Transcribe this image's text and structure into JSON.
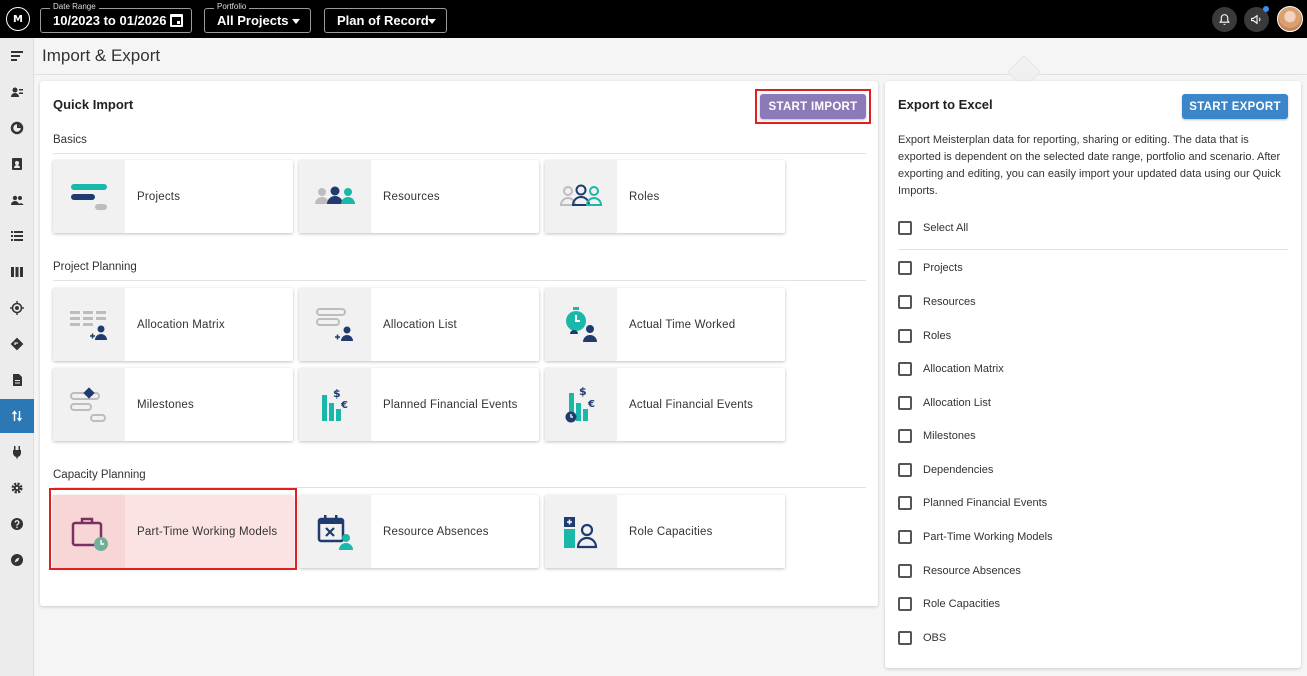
{
  "topbar": {
    "logo_text": "M",
    "date_range": {
      "label": "Date Range",
      "value": "10/2023 to 01/2026"
    },
    "portfolio": {
      "label": "Portfolio",
      "value": "All Projects"
    },
    "scenario": {
      "value": "Plan of Record"
    },
    "icons": [
      "bell-icon",
      "megaphone-icon",
      "user-avatar"
    ]
  },
  "sidebar": {
    "items": [
      "menu-icon",
      "person-list-icon",
      "pie-chart-icon",
      "contact-card-icon",
      "people-icon",
      "list-icon",
      "columns-icon",
      "target-icon",
      "road-sign-icon",
      "document-icon",
      "import-export-icon",
      "plug-icon",
      "gear-icon",
      "help-icon",
      "compass-icon"
    ],
    "active": "import-export-icon"
  },
  "page": {
    "title": "Import & Export"
  },
  "quick_import": {
    "title": "Quick Import",
    "start_button": "START IMPORT",
    "sections": [
      {
        "label": "Basics",
        "cards": [
          "Projects",
          "Resources",
          "Roles"
        ]
      },
      {
        "label": "Project Planning",
        "cards": [
          "Allocation Matrix",
          "Allocation List",
          "Actual Time Worked",
          "Milestones",
          "Planned Financial Events",
          "Actual Financial Events"
        ]
      },
      {
        "label": "Capacity Planning",
        "cards": [
          "Part-Time Working Models",
          "Resource Absences",
          "Role Capacities"
        ]
      }
    ],
    "selected_card": "Part-Time Working Models"
  },
  "export": {
    "title": "Export to Excel",
    "start_button": "START EXPORT",
    "description": "Export Meisterplan data for reporting, sharing or editing. The data that is exported is dependent on the selected date range, portfolio and scenario. After exporting and editing, you can easily import your updated data using our Quick Imports.",
    "select_all": "Select All",
    "options": [
      "Projects",
      "Resources",
      "Roles",
      "Allocation Matrix",
      "Allocation List",
      "Milestones",
      "Dependencies",
      "Planned Financial Events",
      "Part-Time Working Models",
      "Resource Absences",
      "Role Capacities",
      "OBS"
    ]
  },
  "colors": {
    "import_button": "#8c7ab8",
    "export_button": "#3a86c8",
    "teal": "#1ab8a8",
    "navy": "#1f3b70",
    "highlight": "#e02020"
  }
}
